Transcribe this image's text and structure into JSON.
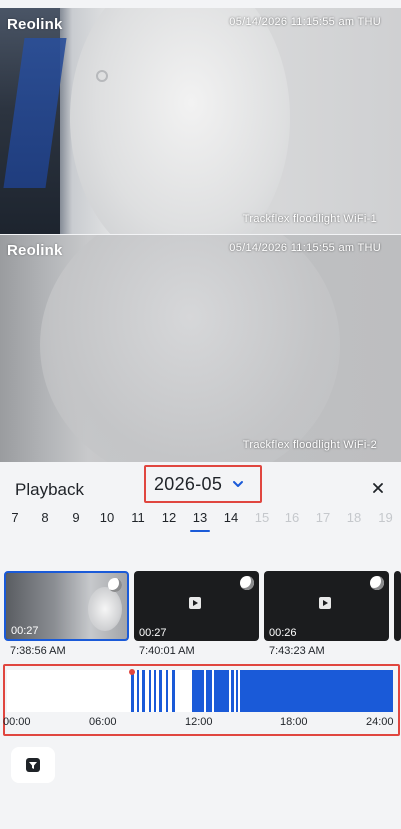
{
  "feeds": [
    {
      "logo": "Reolink",
      "timestamp": "05/14/2026 11:15:55 am THU",
      "camera_name": "Trackflex floodlight WiFi-1"
    },
    {
      "logo": "Reolink",
      "timestamp": "05/14/2026 11:15:55 am THU",
      "camera_name": "Trackflex floodlight WiFi-2"
    }
  ],
  "playback": {
    "title": "Playback",
    "month": "2026-05",
    "days": [
      {
        "label": "7",
        "state": "normal"
      },
      {
        "label": "8",
        "state": "normal"
      },
      {
        "label": "9",
        "state": "normal"
      },
      {
        "label": "10",
        "state": "normal"
      },
      {
        "label": "11",
        "state": "normal"
      },
      {
        "label": "12",
        "state": "normal"
      },
      {
        "label": "13",
        "state": "active"
      },
      {
        "label": "14",
        "state": "normal"
      },
      {
        "label": "15",
        "state": "disabled"
      },
      {
        "label": "16",
        "state": "disabled"
      },
      {
        "label": "17",
        "state": "disabled"
      },
      {
        "label": "18",
        "state": "disabled"
      },
      {
        "label": "19",
        "state": "disabled"
      }
    ],
    "clips": [
      {
        "duration": "00:27",
        "time": "7:38:56 AM",
        "selected": true
      },
      {
        "duration": "00:27",
        "time": "7:40:01 AM",
        "selected": false
      },
      {
        "duration": "00:26",
        "time": "7:43:23 AM",
        "selected": false
      }
    ],
    "timeline_ticks": [
      "00:00",
      "06:00",
      "12:00",
      "18:00",
      "24:00"
    ]
  },
  "colors": {
    "accent": "#1a5ad8",
    "highlight_border": "#e0463f"
  },
  "icons": {
    "close": "close-icon",
    "chevron": "chevron-down-icon",
    "filter": "filter-icon",
    "play": "play-icon"
  }
}
